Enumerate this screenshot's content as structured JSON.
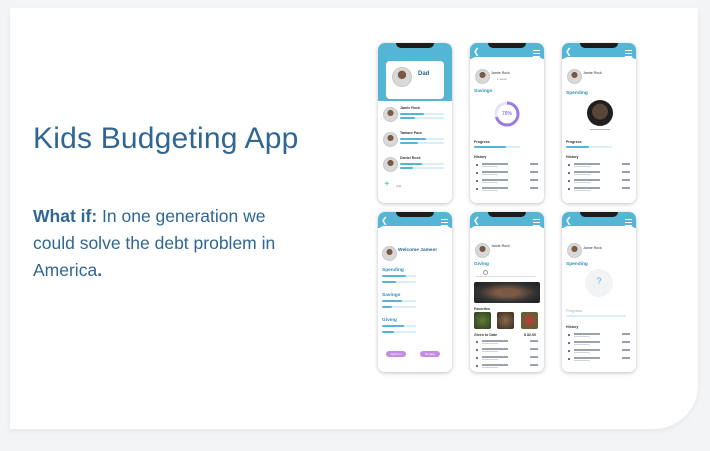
{
  "headline": "Kids Budgeting App",
  "body": {
    "prefix": "What if:",
    "text": " In one generation we could solve the debt problem in America",
    "end": "."
  },
  "screens": {
    "family": {
      "parent_name": "Dad",
      "kids": [
        "Jamie Rock",
        "Tamaro Pace",
        "Daniel Rock"
      ],
      "add_label": "Add"
    },
    "savings": {
      "user_name": "Jamie Rock",
      "sub": "1 week",
      "section": "Savings",
      "percent": "70%",
      "percent_value": 0.7,
      "progress_label": "Progress",
      "history_label": "History"
    },
    "spending": {
      "user_name": "Jamie Rock",
      "section": "Spending",
      "progress_label": "Progress",
      "history_label": "History"
    },
    "welcome": {
      "title": "Welcome James!",
      "sections": [
        "Spending",
        "Savings",
        "Giving"
      ],
      "buttons": [
        "Add Fun",
        "Donate"
      ]
    },
    "giving": {
      "user_name": "Jamie Rock",
      "section": "Giving",
      "favorites_label": "Favorites",
      "given_label": "Given to Date",
      "given_value": "$ 82.00"
    },
    "spending_empty": {
      "user_name": "Jamie Rock",
      "section": "Spending",
      "placeholder": "?",
      "progress_label": "Progress",
      "history_label": "History"
    }
  },
  "colors": {
    "accent": "#54b6d4",
    "text": "#2f6693",
    "purple": "#c58be0"
  }
}
